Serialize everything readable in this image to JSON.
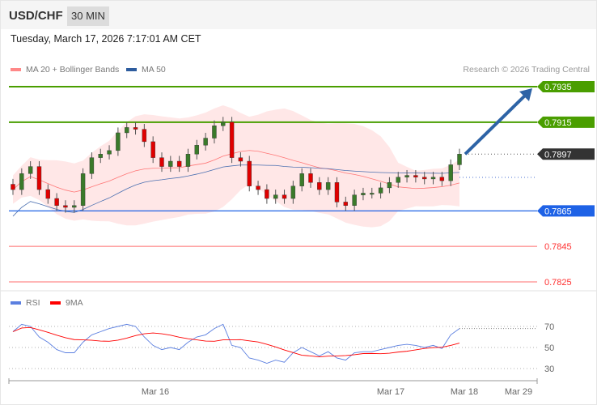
{
  "header": {
    "symbol": "USD/CHF",
    "timeframe": "30 MIN"
  },
  "timestamp": "Tuesday, March 17, 2026 7:17:01 AM CET",
  "legend": {
    "ma20": "MA 20 + Bollinger Bands",
    "ma50": "MA 50",
    "rsi": "RSI",
    "ma9": "9MA"
  },
  "credit": "Research © 2026 Trading Central",
  "colors": {
    "resistance": "#4a9e00",
    "support": "#1e62e6",
    "current": "#333333",
    "target": "#ff3030",
    "arrow": "#2d63a6",
    "bull": "#3a7a2a",
    "bear": "#e00000"
  },
  "chart_data": {
    "type": "candlestick",
    "title": "USD/CHF 30 MIN",
    "ylim": [
      0.7822,
      0.794
    ],
    "levels": [
      {
        "label": "0.7935",
        "value": 0.7935,
        "kind": "resistance"
      },
      {
        "label": "0.7915",
        "value": 0.7915,
        "kind": "resistance"
      },
      {
        "label": "0.7897",
        "value": 0.7897,
        "kind": "current"
      },
      {
        "label": "0.7865",
        "value": 0.7865,
        "kind": "support"
      },
      {
        "label": "0.7845",
        "value": 0.7845,
        "kind": "target"
      },
      {
        "label": "0.7825",
        "value": 0.7825,
        "kind": "target"
      }
    ],
    "closes": [
      0.7877,
      0.7886,
      0.789,
      0.7877,
      0.7872,
      0.7868,
      0.7867,
      0.7868,
      0.7886,
      0.7895,
      0.7897,
      0.7899,
      0.7909,
      0.7912,
      0.7911,
      0.7904,
      0.7895,
      0.789,
      0.7893,
      0.789,
      0.7897,
      0.7902,
      0.7906,
      0.7913,
      0.7915,
      0.7895,
      0.7893,
      0.7879,
      0.7877,
      0.7872,
      0.7874,
      0.7872,
      0.7879,
      0.7886,
      0.7881,
      0.7877,
      0.7881,
      0.787,
      0.7868,
      0.7874,
      0.7875,
      0.7875,
      0.7878,
      0.7881,
      0.7884,
      0.7885,
      0.7884,
      0.7883,
      0.7884,
      0.7882,
      0.7891,
      0.7897
    ],
    "forecast_arrow": {
      "from": 0.7897,
      "to": 0.7935
    },
    "rsi": {
      "ticks": [
        70,
        50,
        30
      ],
      "values": [
        65,
        72,
        70,
        60,
        55,
        48,
        45,
        45,
        55,
        62,
        65,
        68,
        70,
        72,
        70,
        60,
        52,
        48,
        50,
        48,
        55,
        60,
        62,
        68,
        72,
        52,
        50,
        40,
        38,
        35,
        38,
        36,
        45,
        50,
        46,
        42,
        46,
        40,
        38,
        45,
        46,
        46,
        48,
        50,
        52,
        53,
        52,
        50,
        52,
        49,
        62,
        68
      ]
    },
    "x_ticks": [
      "Mar 16",
      "Mar 17",
      "Mar 18",
      "Mar 29"
    ]
  }
}
